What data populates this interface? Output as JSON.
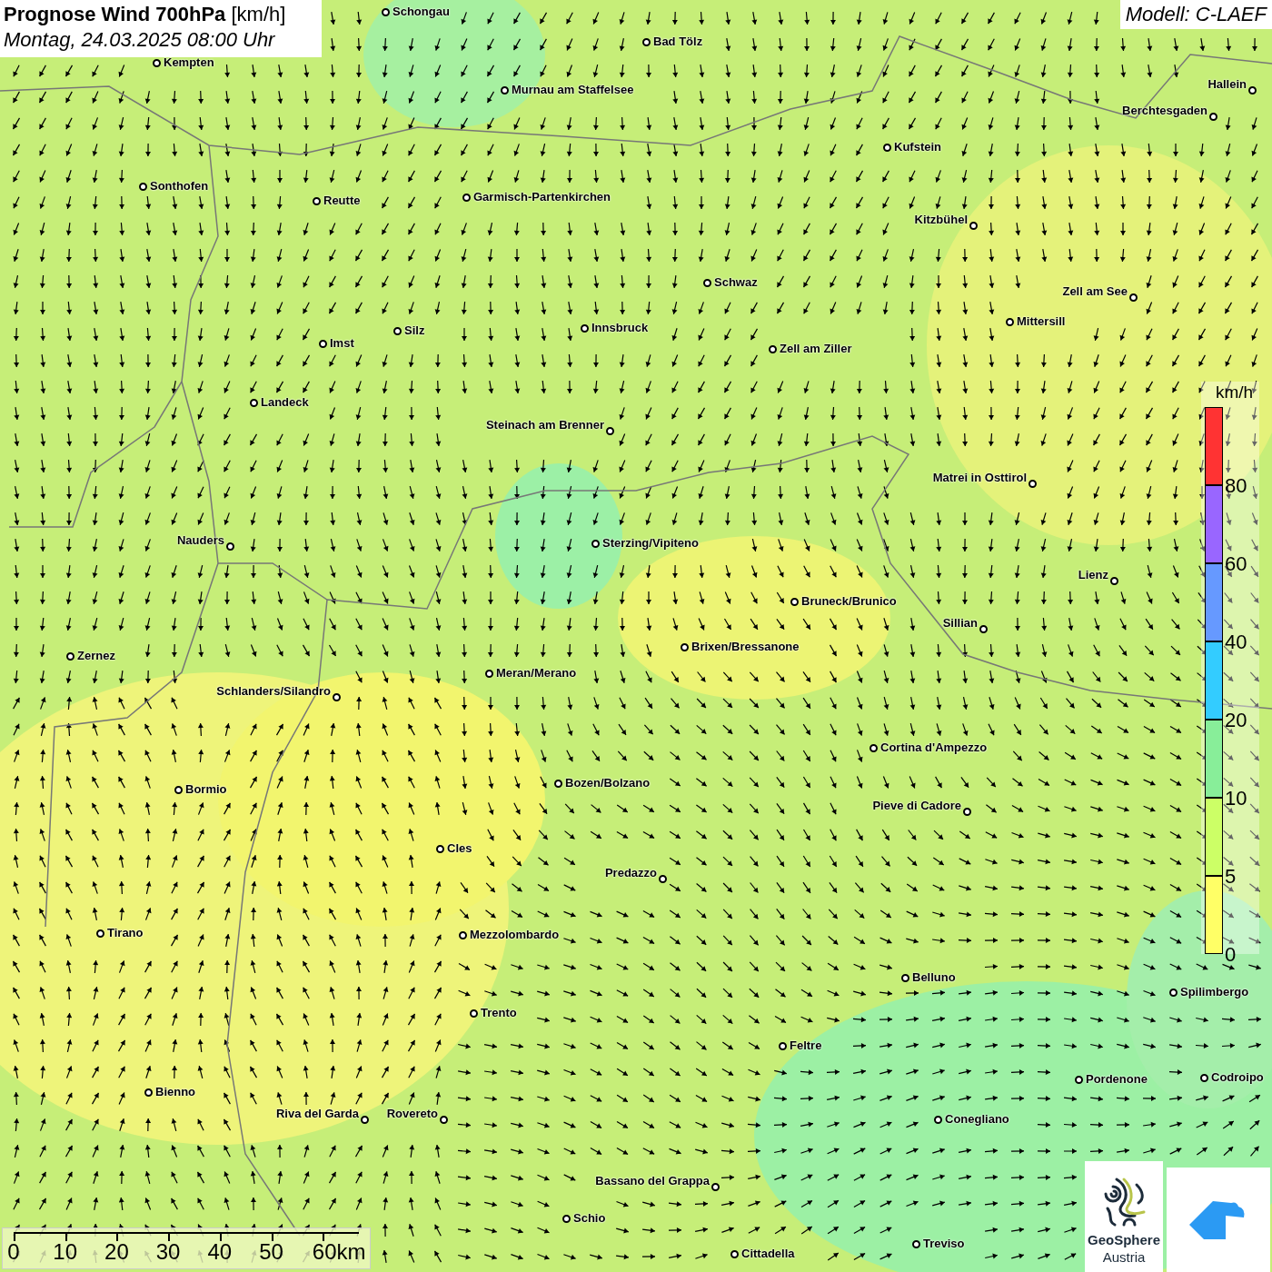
{
  "title": {
    "main": "Prognose Wind 700hPa",
    "unit": "[km/h]",
    "time": "Montag, 24.03.2025 08:00 Uhr"
  },
  "model": "Modell: C-LAEF",
  "cities": [
    {
      "name": "Schongau"
    },
    {
      "name": "Bad Tölz"
    },
    {
      "name": "Kempten"
    },
    {
      "name": "Murnau am Staffelsee"
    },
    {
      "name": "Hallein"
    },
    {
      "name": "Berchtesgaden"
    },
    {
      "name": "Kufstein"
    },
    {
      "name": "Sonthofen"
    },
    {
      "name": "Reutte"
    },
    {
      "name": "Garmisch-Partenkirchen"
    },
    {
      "name": "Kitzbühel"
    },
    {
      "name": "Schwaz"
    },
    {
      "name": "Zell am See"
    },
    {
      "name": "Silz"
    },
    {
      "name": "Innsbruck"
    },
    {
      "name": "Mittersill"
    },
    {
      "name": "Imst"
    },
    {
      "name": "Zell am Ziller"
    },
    {
      "name": "Landeck"
    },
    {
      "name": "Steinach am Brenner"
    },
    {
      "name": "Matrei in Osttirol"
    },
    {
      "name": "Nauders"
    },
    {
      "name": "Sterzing/Vipiteno"
    },
    {
      "name": "Lienz"
    },
    {
      "name": "Bruneck/Brunico"
    },
    {
      "name": "Sillian"
    },
    {
      "name": "Brixen/Bressanone"
    },
    {
      "name": "Zernez"
    },
    {
      "name": "Meran/Merano"
    },
    {
      "name": "Schlanders/Silandro"
    },
    {
      "name": "Cortina d'Ampezzo"
    },
    {
      "name": "Bozen/Bolzano"
    },
    {
      "name": "Bormio"
    },
    {
      "name": "Pieve di Cadore"
    },
    {
      "name": "Cles"
    },
    {
      "name": "Predazzo"
    },
    {
      "name": "Tirano"
    },
    {
      "name": "Mezzolombardo"
    },
    {
      "name": "Belluno"
    },
    {
      "name": "Spilimbergo"
    },
    {
      "name": "Trento"
    },
    {
      "name": "Feltre"
    },
    {
      "name": "Pordenone"
    },
    {
      "name": "Codroipo"
    },
    {
      "name": "Bienno"
    },
    {
      "name": "Riva del Garda"
    },
    {
      "name": "Rovereto"
    },
    {
      "name": "Conegliano"
    },
    {
      "name": "Bassano del Grappa"
    },
    {
      "name": "Schio"
    },
    {
      "name": "Treviso"
    },
    {
      "name": "Cittadella"
    }
  ],
  "legend": {
    "unit": "km/h",
    "bands": [
      {
        "label": "80",
        "color": "#ff3333"
      },
      {
        "label": "60",
        "color": "#9966ff"
      },
      {
        "label": "40",
        "color": "#6699ff"
      },
      {
        "label": "20",
        "color": "#33ccff"
      },
      {
        "label": "10",
        "color": "#88ee99"
      },
      {
        "label": "5",
        "color": "#ccff66"
      },
      {
        "label": "0",
        "color": "#ffff66"
      }
    ]
  },
  "scale_bar": {
    "ticks": [
      "0",
      "10",
      "20",
      "30",
      "40",
      "50",
      "60km"
    ]
  },
  "logo": {
    "lines": [
      "GeoSphere",
      "Austria"
    ]
  }
}
